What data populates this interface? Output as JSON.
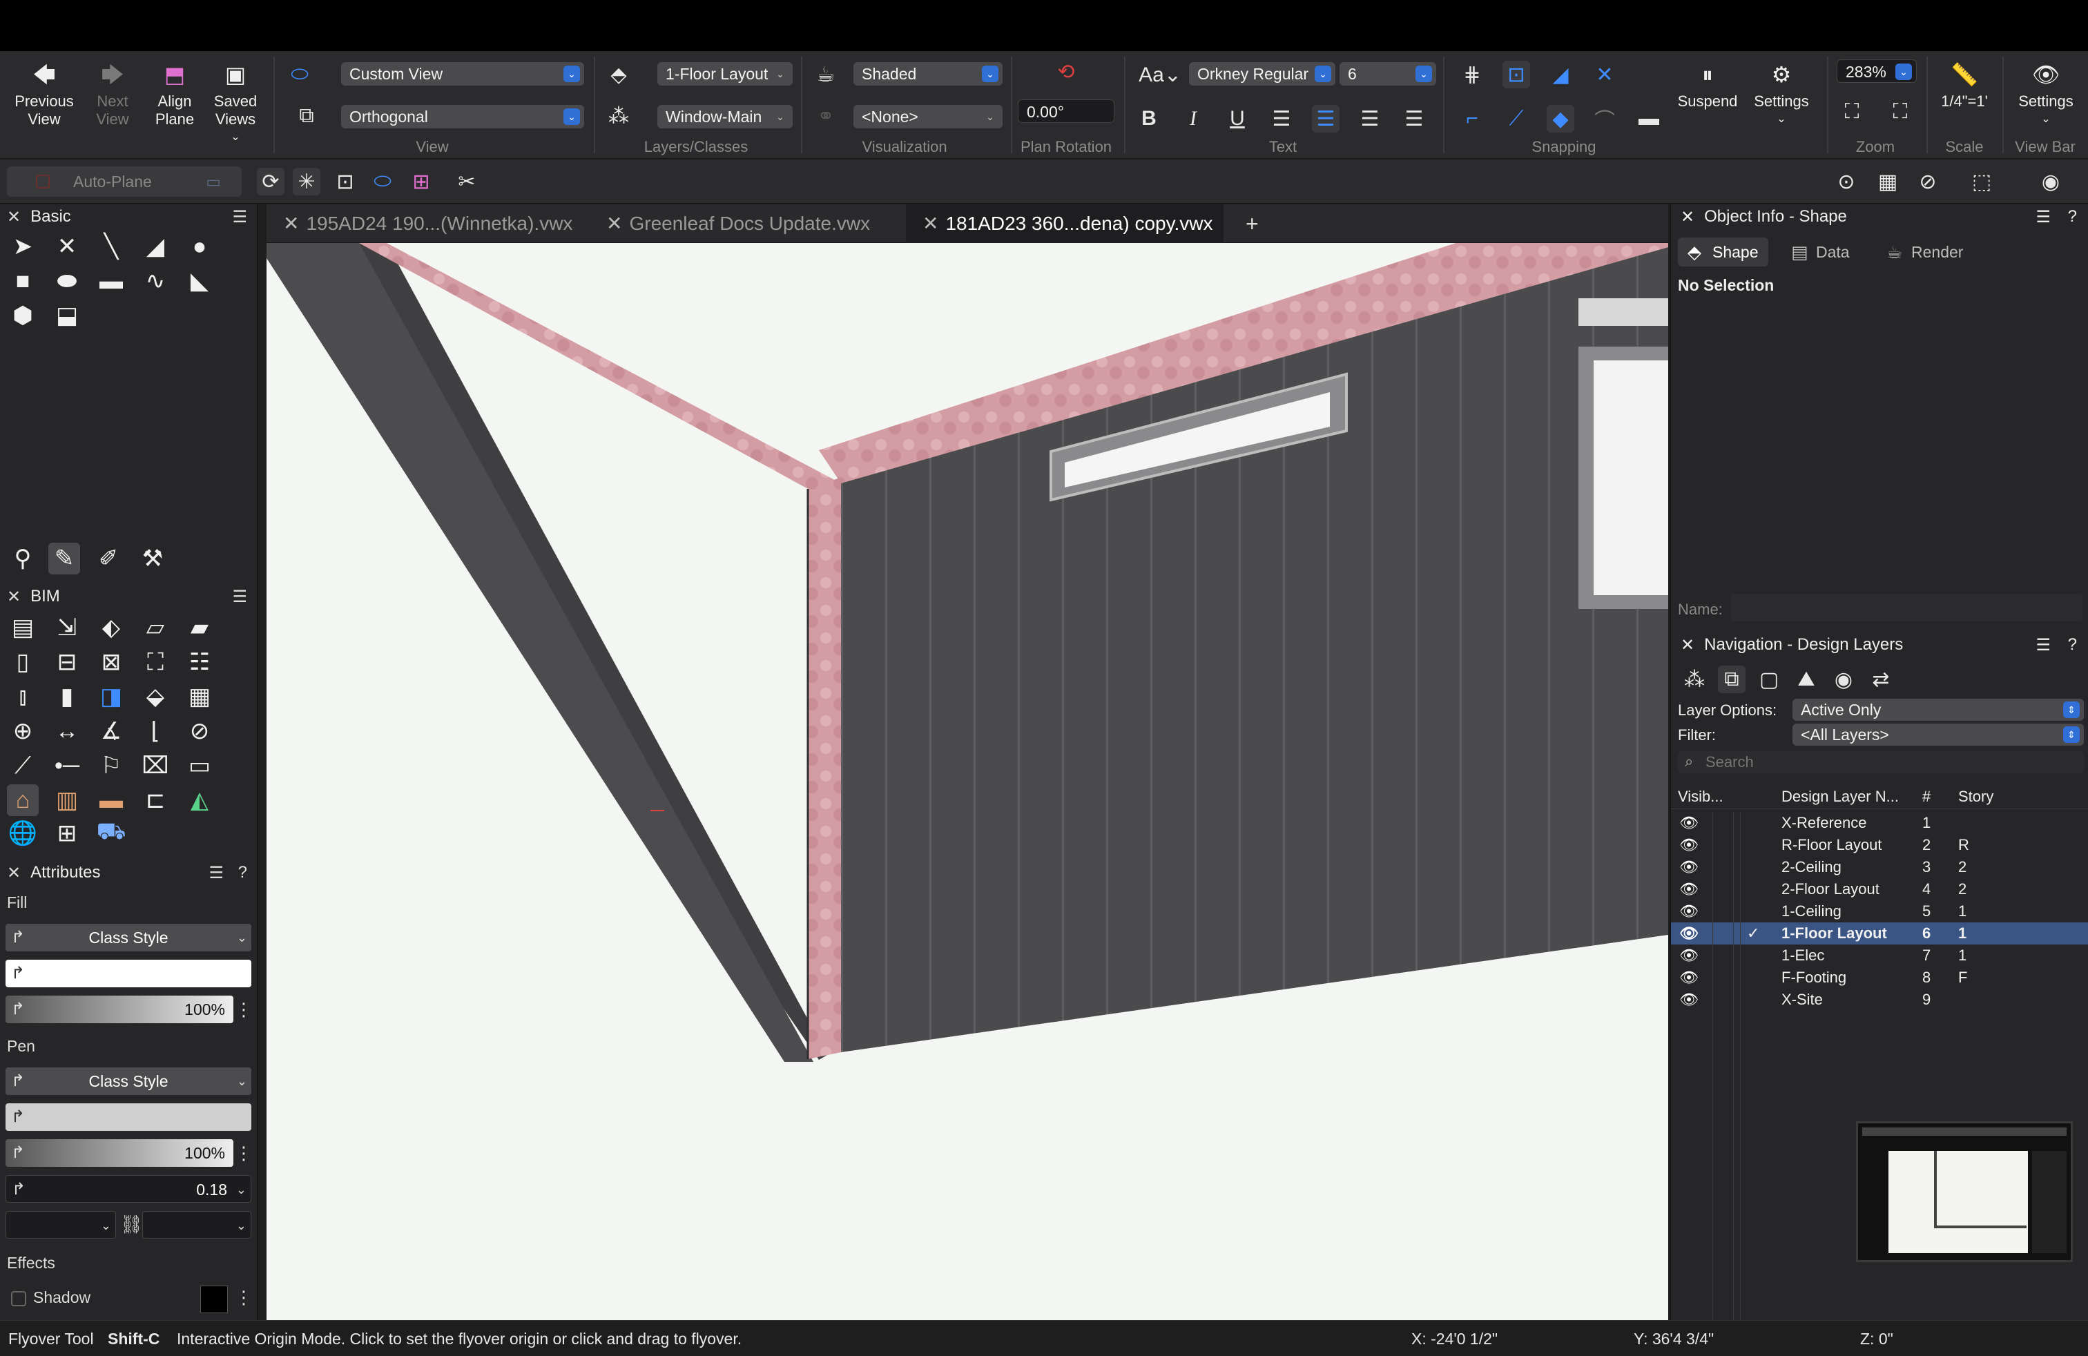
{
  "toolbar": {
    "previous_view": "Previous View",
    "next_view": "Next View",
    "align_plane": "Align Plane",
    "saved_views": "Saved Views",
    "view_dropdown": "Custom View",
    "projection_dropdown": "Orthogonal",
    "layer_dropdown": "1-Floor Layout",
    "class_dropdown": "Window-Main",
    "render_dropdown": "Shaded",
    "lighting_dropdown": "<None>",
    "plan_rotation_value": "0.00°",
    "font_dropdown": "Orkney Regular",
    "font_size_dropdown": "6",
    "suspend": "Suspend",
    "settings": "Settings",
    "zoom_value": "283%",
    "scale_value": "1/4\"=1'",
    "viewbar_settings": "Settings",
    "group_labels": {
      "view": "View",
      "layers_classes": "Layers/Classes",
      "visualization": "Visualization",
      "plan_rotation": "Plan Rotation",
      "text": "Text",
      "snapping": "Snapping",
      "zoom": "Zoom",
      "scale": "Scale",
      "view_bar": "View Bar"
    }
  },
  "toolbar2": {
    "auto_plane": "Auto-Plane"
  },
  "palettes": {
    "basic": "Basic",
    "bim": "BIM",
    "attributes": "Attributes"
  },
  "attributes": {
    "fill_label": "Fill",
    "fill_style": "Class Style",
    "fill_opacity": "100%",
    "pen_label": "Pen",
    "pen_style": "Class Style",
    "pen_opacity": "100%",
    "pen_thickness": "0.18",
    "effects_label": "Effects",
    "shadow_label": "Shadow"
  },
  "doc_tabs": [
    {
      "label": "195AD24 190...(Winnetka).vwx"
    },
    {
      "label": "Greenleaf Docs Update.vwx"
    },
    {
      "label": "181AD23 360...dena) copy.vwx"
    }
  ],
  "object_info": {
    "title": "Object Info - Shape",
    "tabs": [
      "Shape",
      "Data",
      "Render"
    ],
    "selection": "No Selection",
    "name_label": "Name:"
  },
  "navigation": {
    "title": "Navigation - Design Layers",
    "layer_options_label": "Layer Options:",
    "layer_options_value": "Active Only",
    "filter_label": "Filter:",
    "filter_value": "<All Layers>",
    "search_placeholder": "Search",
    "columns": {
      "visibility": "Visib...",
      "name": "Design Layer N...",
      "number": "#",
      "story": "Story"
    },
    "layers": [
      {
        "name": "X-Reference",
        "number": "1",
        "story": ""
      },
      {
        "name": "R-Floor Layout",
        "number": "2",
        "story": "R"
      },
      {
        "name": "2-Ceiling",
        "number": "3",
        "story": "2"
      },
      {
        "name": "2-Floor Layout",
        "number": "4",
        "story": "2"
      },
      {
        "name": "1-Ceiling",
        "number": "5",
        "story": "1"
      },
      {
        "name": "1-Floor Layout",
        "number": "6",
        "story": "1"
      },
      {
        "name": "1-Elec",
        "number": "7",
        "story": "1"
      },
      {
        "name": "F-Footing",
        "number": "8",
        "story": "F"
      },
      {
        "name": "X-Site",
        "number": "9",
        "story": ""
      }
    ],
    "active_layer_index": 5
  },
  "status": {
    "tool": "Flyover Tool",
    "shortcut": "Shift-C",
    "hint": "Interactive Origin Mode. Click to set the flyover origin or click and drag to flyover.",
    "x": "X: -24'0 1/2\"",
    "y": "Y: 36'4 3/4\"",
    "z": "Z: 0\""
  },
  "colors": {
    "accent": "#2f6fd6",
    "selected_row": "#3a5484",
    "canvas": "#f3f6f2",
    "wall": "#4a4a4c",
    "insulation": "#d9a0a6"
  }
}
